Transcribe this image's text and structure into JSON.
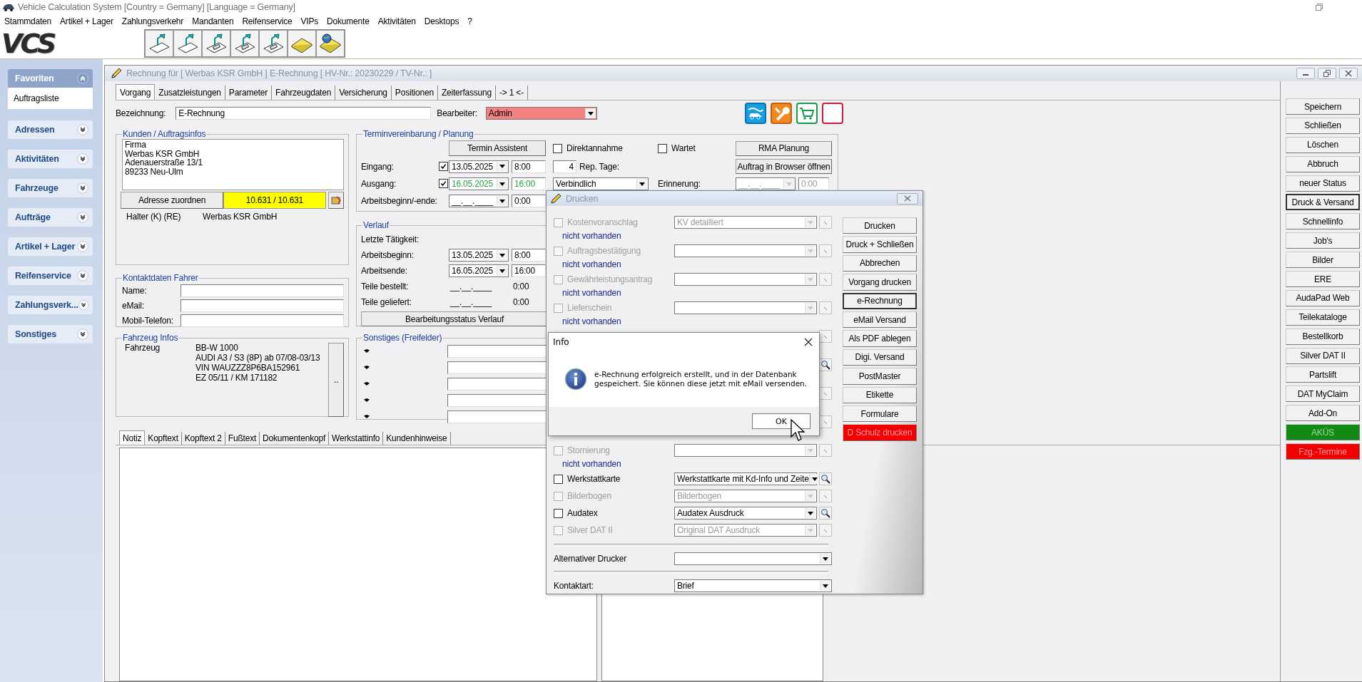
{
  "window": {
    "title": "Vehicle Calculation System [Country = Germany] [Language = Germany]"
  },
  "menu": [
    "Stammdaten",
    "Artikel + Lager",
    "Zahlungsverkehr",
    "Mandanten",
    "Reifenservice",
    "VIPs",
    "Dokumente",
    "Aktivitäten",
    "Desktops",
    "?"
  ],
  "logo": "VCS",
  "sidebar": [
    {
      "title": "Favoriten",
      "expanded": true,
      "items": [
        "Auftragsliste"
      ]
    },
    {
      "title": "Adressen",
      "expanded": false
    },
    {
      "title": "Aktivitäten",
      "expanded": false
    },
    {
      "title": "Fahrzeuge",
      "expanded": false
    },
    {
      "title": "Aufträge",
      "expanded": false
    },
    {
      "title": "Artikel + Lager",
      "expanded": false
    },
    {
      "title": "Reifenservice",
      "expanded": false
    },
    {
      "title": "Zahlungsverk...",
      "expanded": false
    },
    {
      "title": "Sonstiges",
      "expanded": false
    }
  ],
  "document": {
    "title": "Rechnung  für [ Werbas KSR GmbH  ] E-Rechnung [ HV-Nr.: 20230229 / TV-Nr.:  ]",
    "tabs": [
      {
        "label": "Vorgang",
        "selected": true
      },
      {
        "label": "Zusatzleistungen",
        "selected": false
      },
      {
        "label": "Parameter",
        "selected": false
      },
      {
        "label": "Fahrzeugdaten",
        "selected": false
      },
      {
        "label": "Versicherung",
        "selected": false
      },
      {
        "label": "Positionen",
        "selected": false
      },
      {
        "label": "Zeiterfassung",
        "selected": false
      },
      {
        "label": "-> 1 <-",
        "selected": false
      }
    ],
    "bezeichnung": {
      "label": "Bezeichnung:",
      "value": "E-Rechnung"
    },
    "bearbeiter": {
      "label": "Bearbeiter:",
      "value": "Admin"
    },
    "kunden": {
      "title": "Kunden / Auftragsinfos",
      "address": "Firma\nWerbas KSR GmbH\nAdenauerstraße 13/1\n89233 Neu-Ulm",
      "assign_button": "Adresse zuordnen",
      "balance": "10.631 / 10.631",
      "holder_label": "Halter (K) (RE)",
      "holder_value": "Werbas KSR GmbH"
    },
    "kontakt": {
      "title": "Kontaktdaten Fahrer",
      "fields": [
        {
          "label": "Name:"
        },
        {
          "label": "eMail:"
        },
        {
          "label": "Mobil-Telefon:"
        }
      ]
    },
    "fahrzeug": {
      "title": "Fahrzeug Infos",
      "label": "Fahrzeug",
      "details": "BB-W 1000\nAUDI A3 / S3 (8P) ab 07/08-03/13\nVIN WAUZZZ8P6BA152961\nEZ 05/11 / KM 171182",
      "more_button": ".."
    },
    "termin": {
      "title": "Terminvereinbarung / Planung",
      "assistant_button": "Termin Assistent",
      "direktannahme": {
        "label": "Direktannahme",
        "checked": false
      },
      "wartet": {
        "label": "Wartet",
        "checked": false
      },
      "rma_button": "RMA Planung",
      "browser_button": "Auftrag in Browser öffnen",
      "rows": [
        {
          "label": "Eingang:",
          "kind": "check",
          "checked": true,
          "date": "13.05.2025",
          "time": "8:00",
          "color": "#000000"
        },
        {
          "label": "Ausgang:",
          "kind": "check",
          "checked": true,
          "date": "16.05.2025",
          "time": "16:00",
          "color": "#2aa046"
        },
        {
          "label": "Arbeitsbeginn/-ende:",
          "kind": "plain",
          "date": "__.__.____",
          "time": "0:00"
        }
      ],
      "rep_days_value": "4",
      "rep_days_label": "Rep. Tage:",
      "commitment": "Verbindlich",
      "reminder_label": "Erinnerung:",
      "reminder_date": "__.__.____",
      "reminder_time": "0:00"
    },
    "verlauf": {
      "title": "Verlauf",
      "last_activity_label": "Letzte Tätigkeit:",
      "rows": [
        {
          "label": "Arbeitsbeginn:",
          "kind": "combo",
          "date": "13.05.2025",
          "time": "8:00"
        },
        {
          "label": "Arbeitsende:",
          "kind": "combo",
          "date": "16.05.2025",
          "time": "16:00"
        },
        {
          "label": "Teile bestellt:",
          "kind": "text",
          "date": "__.__.____",
          "time": "0:00"
        },
        {
          "label": "Teile geliefert:",
          "kind": "text",
          "date": "__.__.____",
          "time": "0:00"
        }
      ],
      "status_button": "Bearbeitungsstatus Verlauf"
    },
    "sonstiges": {
      "title": "Sonstiges (Freifelder)",
      "fields": [
        {
          "kind": "field"
        },
        {
          "kind": "field"
        },
        {
          "kind": "field"
        },
        {
          "kind": "field"
        },
        {
          "kind": "field"
        }
      ]
    },
    "notes_tabs": [
      {
        "label": "Notiz",
        "selected": true
      },
      {
        "label": "Kopftext",
        "selected": false
      },
      {
        "label": "Kopftext 2",
        "selected": false
      },
      {
        "label": "Fußtext",
        "selected": false
      },
      {
        "label": "Dokumentenkopf",
        "selected": false
      },
      {
        "label": "Werkstattinfo",
        "selected": false
      },
      {
        "label": "Kundenhinweise",
        "selected": false
      }
    ]
  },
  "actions": [
    {
      "label": "Speichern",
      "kind": "default"
    },
    {
      "label": "Schließen",
      "kind": "default"
    },
    {
      "label": "Löschen",
      "kind": "default"
    },
    {
      "label": "Abbruch",
      "kind": "default"
    },
    {
      "label": "neuer Status",
      "kind": "default"
    },
    {
      "label": "Druck & Versand",
      "kind": "focused"
    },
    {
      "label": "Schnellinfo",
      "kind": "default"
    },
    {
      "label": "Job's",
      "kind": "default"
    },
    {
      "label": "Bilder",
      "kind": "default"
    },
    {
      "label": "ERE",
      "kind": "default"
    },
    {
      "label": "AudaPad Web",
      "kind": "default"
    },
    {
      "label": "Teilekataloge",
      "kind": "default"
    },
    {
      "label": "Bestellkorb",
      "kind": "default"
    },
    {
      "label": "Silver DAT II",
      "kind": "default"
    },
    {
      "label": "Partslift",
      "kind": "default"
    },
    {
      "label": "DAT MyClaim",
      "kind": "default"
    },
    {
      "label": "Add-On",
      "kind": "default"
    },
    {
      "label": "AKÜS",
      "kind": "green"
    },
    {
      "label": "Fzg.-Termine",
      "kind": "red"
    }
  ],
  "print_dialog": {
    "title": "Drucken",
    "documents": [
      {
        "kind": "document",
        "label": "Kostenvoranschlag",
        "enabled": false,
        "checked": false,
        "value": "KV detailliert",
        "status": "nicht vorhanden",
        "searchable": false
      },
      {
        "kind": "document",
        "label": "Auftragsbestätigung",
        "enabled": false,
        "checked": false,
        "status": "nicht vorhanden",
        "searchable": false
      },
      {
        "kind": "document",
        "label": "Gewährleistungsantrag",
        "enabled": false,
        "checked": false,
        "status": "nicht vorhanden",
        "searchable": false
      },
      {
        "kind": "document",
        "label": "Lieferschein",
        "enabled": false,
        "checked": false,
        "status": "nicht vorhanden",
        "searchable": false
      },
      {
        "kind": "document",
        "searchable": false
      },
      {
        "kind": "document",
        "searchable": true
      },
      {
        "kind": "document",
        "searchable": false
      },
      {
        "kind": "document",
        "searchable": false
      },
      {
        "kind": "document",
        "label": "Stornierung",
        "enabled": false,
        "checked": false,
        "status": "nicht vorhanden",
        "searchable": false
      },
      {
        "kind": "single",
        "label": "Werkstattkarte",
        "enabled": true,
        "checked": false,
        "value": "Werkstattkarte mit Kd-Info und Zeite",
        "searchable": true
      },
      {
        "kind": "single",
        "label": "Bilderbogen",
        "enabled": false,
        "checked": false,
        "value": "Bilderbogen",
        "searchable": false
      },
      {
        "kind": "single",
        "label": "Audatex",
        "enabled": true,
        "checked": false,
        "value": "Audatex Ausdruck",
        "searchable": true
      },
      {
        "kind": "single",
        "label": "Silver DAT II",
        "enabled": false,
        "checked": false,
        "value": "Original DAT Ausdruck",
        "searchable": false
      }
    ],
    "alt_printer_label": "Alternativer Drucker",
    "contact_label": "Kontaktart:",
    "contact_value": "Brief",
    "buttons": [
      {
        "label": "Drucken",
        "kind": "default"
      },
      {
        "label": "Druck + Schließen",
        "kind": "default"
      },
      {
        "label": "Abbrechen",
        "kind": "default"
      },
      {
        "label": "Vorgang drucken",
        "kind": "default"
      },
      {
        "label": "e-Rechnung",
        "kind": "focused"
      },
      {
        "label": "eMail Versand",
        "kind": "default"
      },
      {
        "label": "Als PDF ablegen",
        "kind": "default"
      },
      {
        "label": "Digi. Versand",
        "kind": "default"
      },
      {
        "label": "PostMaster",
        "kind": "default"
      },
      {
        "label": "Etikette",
        "kind": "default"
      },
      {
        "label": "Formulare",
        "kind": "default"
      },
      {
        "label": "D Schulz drucken",
        "kind": "red"
      }
    ]
  },
  "info_dialog": {
    "title": "Info",
    "message": "e-Rechnung erfolgreich erstellt, und in der Datenbank\ngespeichert. Sie können diese jetzt mit eMail versenden.",
    "ok_button": "OK"
  }
}
